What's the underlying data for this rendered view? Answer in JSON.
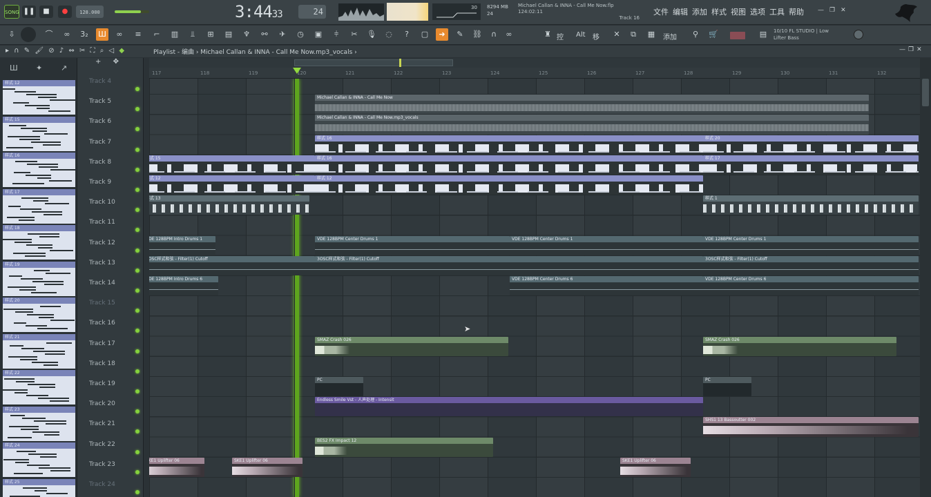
{
  "transport": {
    "song_badge": "SONG",
    "play_icon": "pause-icon",
    "stop_icon": "stop-icon",
    "record_icon": "record-icon",
    "tempo": "128",
    "tempo_frac": ".000",
    "master_volume": 0.75,
    "time_main": "3:44",
    "time_sub": "33",
    "pattern_number": "24",
    "mini_top": "30",
    "cpu_mem": "8294 MB",
    "cpu_poly": "24",
    "hint_title": "Michael Callan & INNA - Call Me Now.flp",
    "hint_time": "124:02:11",
    "hint_track": "Track 16"
  },
  "menu": [
    "文件",
    "编辑",
    "添加",
    "样式",
    "视图",
    "选项",
    "工具",
    "帮助"
  ],
  "window_controls": [
    "minimize-icon",
    "restore-icon",
    "close-icon"
  ],
  "toolbar": {
    "link_label": "控",
    "alt_label": "Alt",
    "move_label": "移",
    "add_label": "添加",
    "plugin_counter": "10/10",
    "plugin_title": "FL STUDIO | Low",
    "plugin_sub": "Lifter Bass"
  },
  "playlist": {
    "title": "Playlist - 编曲 › Michael Callan & INNA - Call Me Now.mp3_vocals ›"
  },
  "ruler": [
    "117",
    "118",
    "119",
    "120",
    "121",
    "122",
    "123",
    "124",
    "125",
    "126",
    "127",
    "128",
    "129",
    "130",
    "131",
    "132"
  ],
  "picker_patterns": [
    "样式 12",
    "样式 15",
    "样式 16",
    "样式 17",
    "样式 18",
    "样式 19",
    "样式 20",
    "样式 21",
    "样式 22",
    "样式 23",
    "样式 24",
    "样式 25"
  ],
  "tracks": [
    "Track 4",
    "Track 5",
    "Track 6",
    "Track 7",
    "Track 8",
    "Track 9",
    "Track 10",
    "Track 11",
    "Track 12",
    "Track 13",
    "Track 14",
    "Track 15",
    "Track 16",
    "Track 17",
    "Track 18",
    "Track 19",
    "Track 20",
    "Track 21",
    "Track 22",
    "Track 23",
    "Track 24"
  ],
  "clips": [
    {
      "label": "Michael Callan & INNA - Call Me Now"
    },
    {
      "label": "Michael Callan & INNA - Call Me Now.mp3_vocals"
    },
    {
      "label": "样式 16"
    },
    {
      "label": "样式 20"
    },
    {
      "label": "样式 15"
    },
    {
      "label": "样式 16"
    },
    {
      "label": "样式 17"
    },
    {
      "label": "样式 12"
    },
    {
      "label": "样式 12"
    },
    {
      "label": "样式 13"
    },
    {
      "label": "样式 1"
    },
    {
      "label": "VDE 128BPM Intro Drums 1"
    },
    {
      "label": "VDE 128BPM Center Drums 1"
    },
    {
      "label": "VDE 128BPM Center Drums 1"
    },
    {
      "label": "VDE 128BPM Center Drums 1"
    },
    {
      "label": "3OSC样式和弦 - Filter(1) Cutoff"
    },
    {
      "label": "3OSC样式和弦 - Filter(1) Cutoff"
    },
    {
      "label": "3OSC样式和弦 - Filter(1) Cutoff"
    },
    {
      "label": "VDE 128BPM Intro Drums 6"
    },
    {
      "label": "VDE 128BPM Center Drums 6"
    },
    {
      "label": "VDE 128BPM Center Drums 6"
    },
    {
      "label": "SMAZ Crash 026"
    },
    {
      "label": "SMAZ Crash 026"
    },
    {
      "label": "PC"
    },
    {
      "label": "PC"
    },
    {
      "label": "Endless Smile Vst - 人声处理 - Intensit"
    },
    {
      "label": "SHS1 13 Bassoutter 002"
    },
    {
      "label": "BES2 FX Impact 12"
    },
    {
      "label": "SKE1 Uplifter 06"
    },
    {
      "label": "SKE1 Uplifter 06"
    },
    {
      "label": "SKE1 Uplifter 06"
    }
  ]
}
